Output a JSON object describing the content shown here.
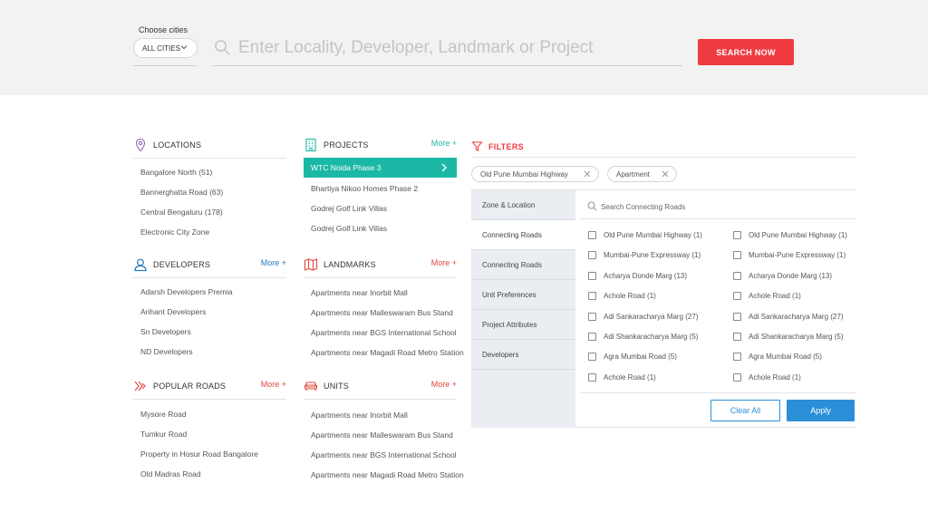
{
  "header": {
    "city_label": "Choose cities",
    "city_value": "ALL CITIES",
    "search_placeholder": "Enter Locality, Developer, Landmark or Project",
    "search_button": "SEARCH NOW"
  },
  "locations": {
    "title": "LOCATIONS",
    "items": [
      "Bangalore North (51)",
      "Bannerghatta Road (63)",
      "Central Bengaluru (178)",
      "Electronic City Zone"
    ]
  },
  "developers": {
    "title": "DEVELOPERS",
    "more": "More +",
    "items": [
      "Adarsh Developers Premia",
      "Arihant Developers",
      "Sn Developers",
      "ND Developers"
    ]
  },
  "popular_roads": {
    "title": "POPULAR ROADS",
    "more": "More +",
    "items": [
      "Mysore Road",
      "Tumkur Road",
      "Property in Hosur Road Bangalore",
      "Old Madras Road"
    ]
  },
  "projects": {
    "title": "PROJECTS",
    "more": "More +",
    "active": "WTC Noida Phase 3",
    "items": [
      "Bhartiya Nikoo Homes Phase 2",
      "Godrej Golf Link Villas",
      "Godrej Golf Link Villas"
    ]
  },
  "landmarks": {
    "title": "LANDMARKS",
    "more": "More +",
    "items": [
      "Apartments near Inorbit Mall",
      "Apartments near Malleswaram Bus Stand",
      "Apartments near BGS International School",
      "Apartments near Magadi Road Metro Station"
    ]
  },
  "units": {
    "title": "UNITS",
    "more": "More +",
    "items": [
      "Apartments near Inorbit Mall",
      "Apartments near Malleswaram Bus Stand",
      "Apartments near BGS International School",
      "Apartments near Magadi Road Metro Station"
    ]
  },
  "filters": {
    "title": "FILTERS",
    "chips": [
      "Old Pune Mumbai Highway",
      "Apartment"
    ],
    "tabs": [
      "Zone & Location",
      "Connecting Roads",
      "Connecting Roads",
      "Unit Preferences",
      "Project Attributes",
      "Developers"
    ],
    "active_tab": 1,
    "panel_search_placeholder": "Search Connecting Roads",
    "options_left": [
      "Old Pune Mumbai Highway (1)",
      "Mumbai-Pune Expressway (1)",
      "Acharya Donde Marg (13)",
      "Achole Road (1)",
      "Adi Sankaracharya Marg (27)",
      "Adi Shankaracharya Marg (5)",
      "Agra Mumbai Road (5)",
      "Achole Road (1)"
    ],
    "options_right": [
      "Old Pune Mumbai Highway (1)",
      "Mumbai-Pune Expressway (1)",
      "Acharya Donde Marg (13)",
      "Achole Road (1)",
      "Adi Sankaracharya Marg (27)",
      "Adi Shankaracharya Marg (5)",
      "Agra Mumbai Road (5)",
      "Achole Road (1)"
    ],
    "clear_label": "Clear All",
    "apply_label": "Apply"
  },
  "colors": {
    "accent_red": "#ef3b40",
    "teal": "#1cb8a6",
    "blue": "#2a8fd6",
    "more_red": "#e0483d",
    "more_blue": "#2a7bbf"
  },
  "icons": {
    "locations": "map-pin-icon",
    "developers": "user-icon",
    "popular_roads": "road-icon",
    "projects": "building-icon",
    "landmarks": "map-icon",
    "units": "sofa-icon",
    "filters": "funnel-icon"
  }
}
